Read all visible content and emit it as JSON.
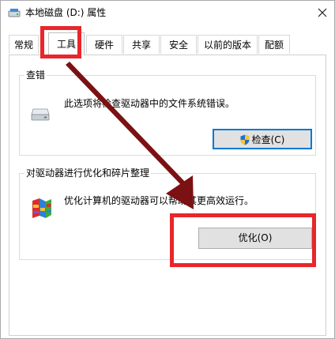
{
  "window": {
    "title": "本地磁盘 (D:) 属性",
    "icons": {
      "title": "drive-icon",
      "close": "close-icon"
    }
  },
  "tabs": [
    {
      "label": "常规",
      "active": false
    },
    {
      "label": "工具",
      "active": true
    },
    {
      "label": "硬件",
      "active": false
    },
    {
      "label": "共享",
      "active": false
    },
    {
      "label": "安全",
      "active": false
    },
    {
      "label": "以前的版本",
      "active": false
    },
    {
      "label": "配额",
      "active": false
    }
  ],
  "error_check": {
    "title": "查错",
    "description": "此选项将检查驱动器中的文件系统错误。",
    "button_label": "检查(C)",
    "icons": {
      "main": "hard-drive-icon",
      "button": "uac-shield-icon"
    }
  },
  "optimize": {
    "title": "对驱动器进行优化和碎片整理",
    "description": "优化计算机的驱动器可以帮助其更高效运行。",
    "button_label": "优化(O)",
    "icons": {
      "main": "defrag-icon"
    }
  },
  "annotations": {
    "highlight_color": "#e8262b",
    "arrow_color": "#7b1113"
  }
}
